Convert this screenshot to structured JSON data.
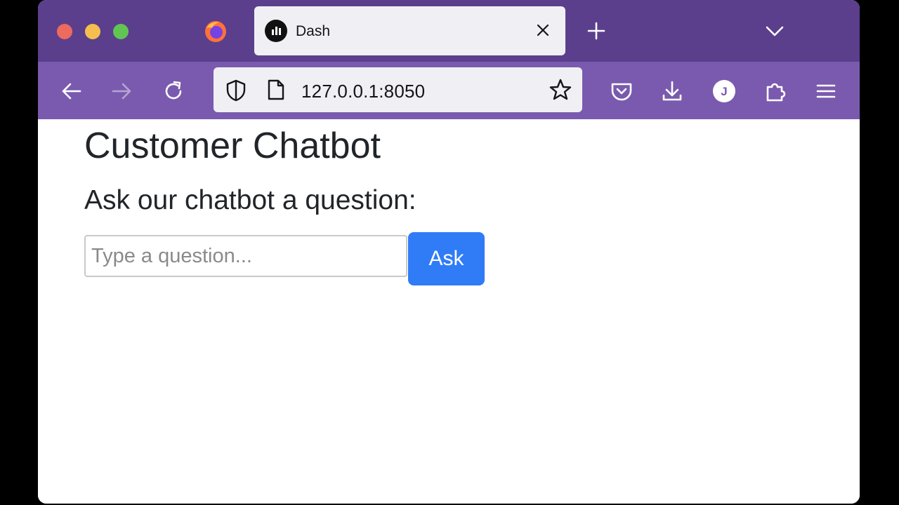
{
  "browser": {
    "tab": {
      "title": "Dash"
    },
    "url": "127.0.0.1:8050",
    "colors": {
      "tabbar": "#5b3f8c",
      "navbar": "#7a5aae"
    },
    "account_initial": "J"
  },
  "page": {
    "title": "Customer Chatbot",
    "prompt": "Ask our chatbot a question:",
    "input_placeholder": "Type a question...",
    "input_value": "",
    "ask_label": "Ask",
    "accent": "#2f7cf6"
  }
}
